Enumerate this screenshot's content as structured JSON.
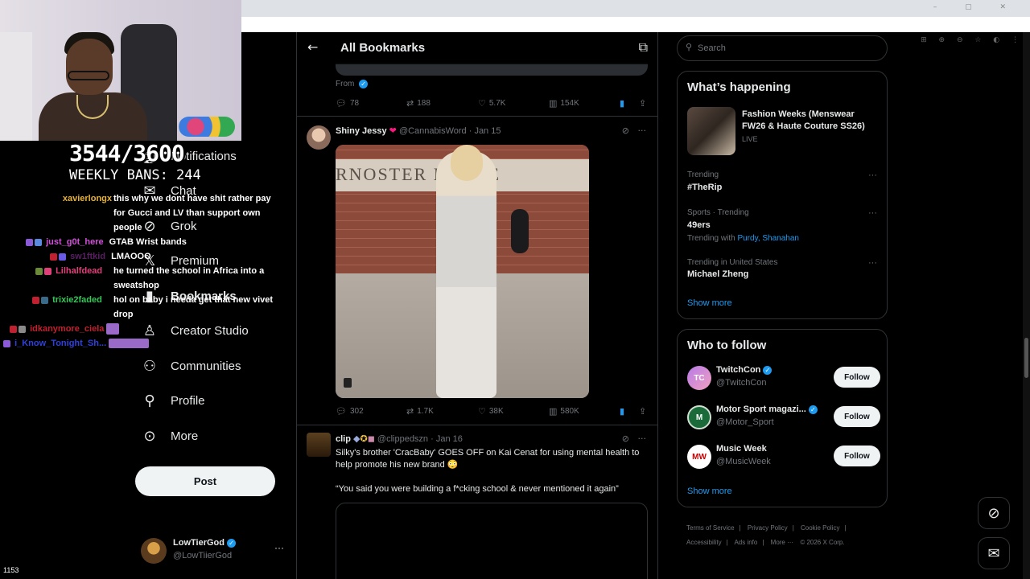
{
  "stream": {
    "sub_counter": "3544/3600",
    "weekly_bans": "WEEKLY BANS: 244",
    "viewer_count": "1153",
    "chat": [
      {
        "user": "xavierlongx",
        "user_color": "#e6b23a",
        "msg": "this why we dont have shit rather pay for Gucci and LV than support own people"
      },
      {
        "user": "just_g0t_here",
        "user_color": "#d050d8",
        "msg": "GTAB Wrist bands"
      },
      {
        "user": "sw1ftkid",
        "user_color": "#5a1e63",
        "msg": "LMAOOO"
      },
      {
        "user": "Lilhalfdead",
        "user_color": "#e0407a",
        "msg": "he turned the school in Africa into a sweatshop"
      },
      {
        "user": "trixie2faded",
        "user_color": "#36c75a",
        "msg": "hol on baby i needa get that new vivet drop"
      },
      {
        "user": "idkanymore_ciela",
        "user_color": "#c02030",
        "msg": ""
      },
      {
        "user": "i_Know_Tonight_Sh...",
        "user_color": "#3040d8",
        "msg": ""
      }
    ]
  },
  "nav": {
    "items": [
      {
        "label": "Notifications",
        "icon": "bell-icon"
      },
      {
        "label": "Chat",
        "icon": "mail-icon"
      },
      {
        "label": "Grok",
        "icon": "grok-icon"
      },
      {
        "label": "Premium",
        "icon": "x-logo-icon"
      },
      {
        "label": "Bookmarks",
        "icon": "bookmark-icon"
      },
      {
        "label": "Creator Studio",
        "icon": "creator-studio-icon"
      },
      {
        "label": "Communities",
        "icon": "communities-icon"
      },
      {
        "label": "Profile",
        "icon": "profile-icon"
      },
      {
        "label": "More",
        "icon": "more-circle-icon"
      }
    ],
    "post_label": "Post"
  },
  "account": {
    "name": "LowTierGod",
    "handle": "@LowTiierGod"
  },
  "main": {
    "title": "All Bookmarks",
    "top_tweet": {
      "from_label": "From",
      "replies": "78",
      "reposts": "188",
      "likes": "5.7K",
      "views": "154K"
    },
    "tweet1": {
      "name": "Shiny Jessy",
      "handle_date": "@CannabisWord · Jan 15",
      "sign_text": "RNOSTER HOUSE",
      "replies": "302",
      "reposts": "1.7K",
      "likes": "38K",
      "views": "580K"
    },
    "tweet2": {
      "name": "clip",
      "handle_date": "@clippedszn · Jan 16",
      "text1": "Silky's brother 'CracBaby' GOES OFF on Kai Cenat for using mental health to help promote his new brand 😳",
      "text2": "“You said you were building a f*cking school & never mentioned it again”"
    }
  },
  "right": {
    "search_placeholder": "Search",
    "happening_title": "What’s happening",
    "fashion": {
      "title": "Fashion Weeks (Menswear FW26 & Haute Couture SS26)",
      "status": "LIVE"
    },
    "trends": [
      {
        "meta": "Trending",
        "name": "#TheRip",
        "with": ""
      },
      {
        "meta": "Sports · Trending",
        "name": "49ers",
        "with": "Purdy, Shanahan"
      },
      {
        "meta": "Trending in United States",
        "name": "Michael Zheng",
        "with": ""
      }
    ],
    "trending_with_label": "Trending with",
    "show_more": "Show more",
    "follow_title": "Who to follow",
    "follow": [
      {
        "name": "TwitchCon",
        "handle": "@TwitchCon",
        "btn": "Follow"
      },
      {
        "name": "Motor Sport magazi...",
        "handle": "@Motor_Sport",
        "btn": "Follow"
      },
      {
        "name": "Music Week",
        "handle": "@MusicWeek",
        "btn": "Follow"
      }
    ],
    "follow_show_more": "Show more",
    "footer": [
      "Terms of Service",
      "|",
      "Privacy Policy",
      "|",
      "Cookie Policy",
      "|",
      "Accessibility",
      "|",
      "Ads info",
      "|",
      "More ···",
      "© 2026 X Corp."
    ]
  },
  "colors": {
    "accent": "#1d9bf0",
    "background": "#000000",
    "border": "#2f3336"
  }
}
